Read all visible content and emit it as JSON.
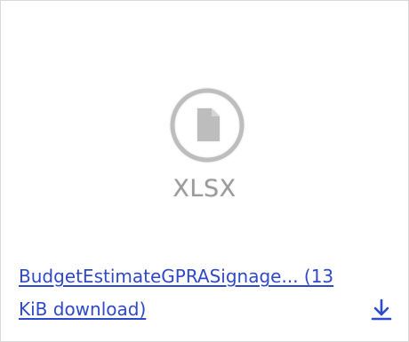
{
  "attachment": {
    "file_type": "XLSX",
    "link_text": "BudgetEstimateGPRASignage... (13 KiB download)"
  },
  "icons": {
    "file": "document-icon",
    "download": "download-arrow-icon"
  },
  "colors": {
    "link": "#2f49c8",
    "icon_gray": "#bdbdbd",
    "file_type_text": "#9a9a9a",
    "border": "#d9d9d9"
  }
}
